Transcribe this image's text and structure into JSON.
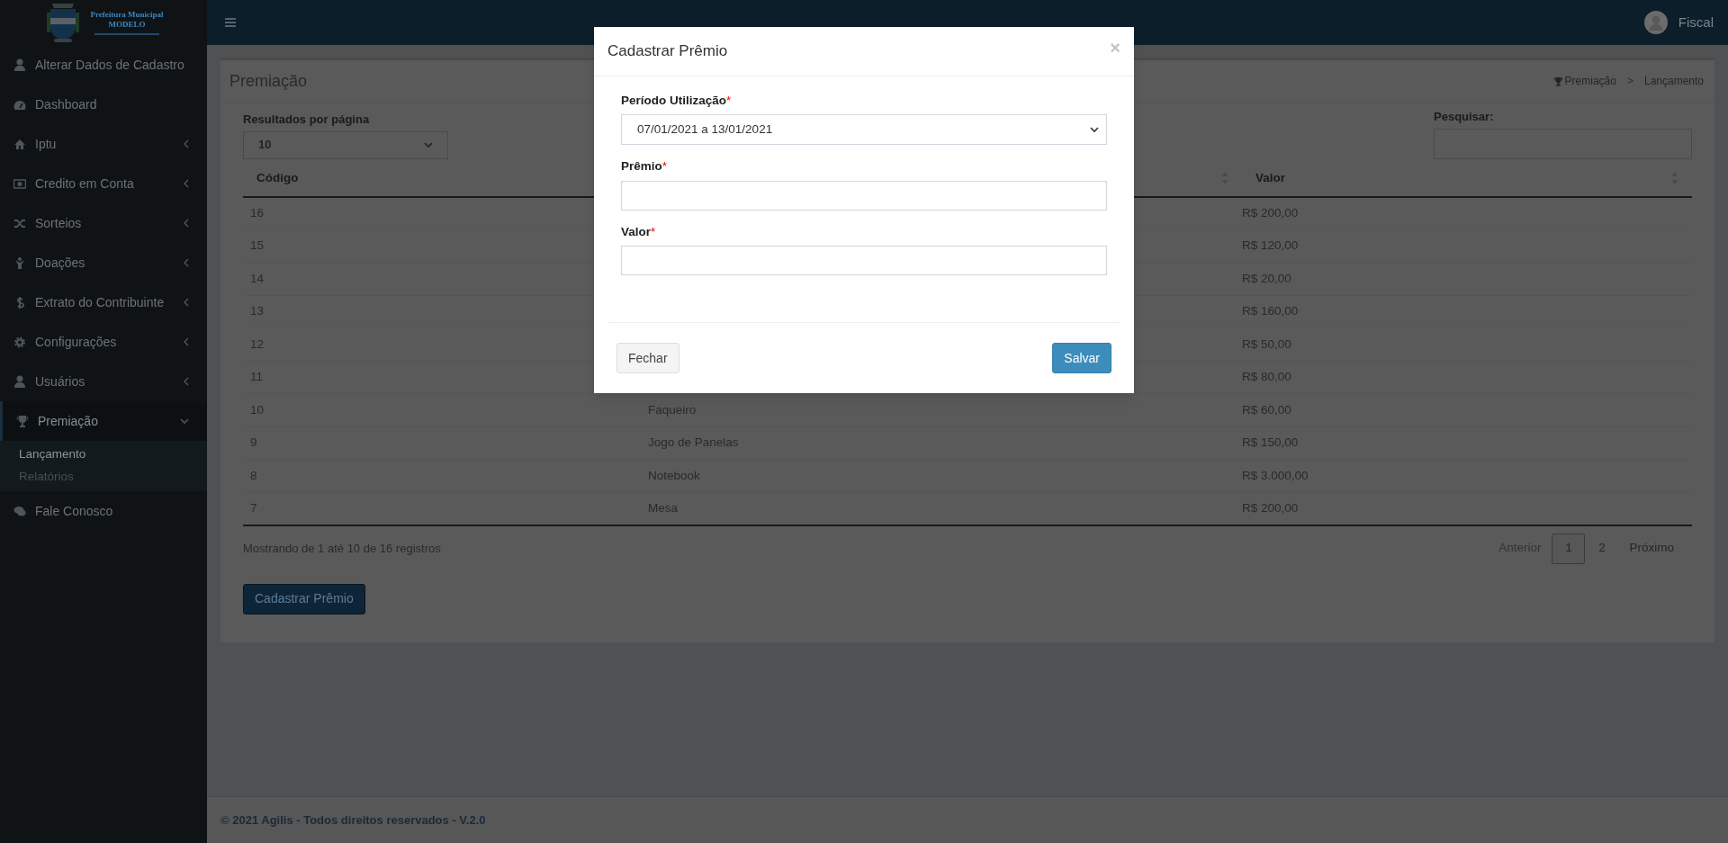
{
  "logo": {
    "lines": [
      "Prefeitura Municipal",
      "MODELO"
    ]
  },
  "sidebar": {
    "items": [
      {
        "label": "Alterar Dados de Cadastro",
        "kind": "link",
        "selected": false
      },
      {
        "label": "Dashboard",
        "kind": "link",
        "selected": false
      },
      {
        "label": "Iptu",
        "kind": "menu",
        "expanded": false,
        "selected": false
      },
      {
        "label": "Credito em Conta",
        "kind": "menu",
        "expanded": false,
        "selected": false
      },
      {
        "label": "Sorteios",
        "kind": "menu",
        "expanded": false,
        "selected": false
      },
      {
        "label": "Doações",
        "kind": "menu",
        "expanded": false,
        "selected": false
      },
      {
        "label": "Extrato do Contribuinte",
        "kind": "menu",
        "expanded": false,
        "selected": false
      },
      {
        "label": "Configurações",
        "kind": "menu",
        "expanded": false,
        "selected": false
      },
      {
        "label": "Usuários",
        "kind": "menu",
        "expanded": false,
        "selected": false
      },
      {
        "label": "Premiação",
        "kind": "menu",
        "expanded": true,
        "selected": true,
        "children": [
          {
            "label": "Lançamento",
            "selected": true
          },
          {
            "label": "Relatórios",
            "selected": false
          }
        ]
      },
      {
        "label": "Fale Conosco",
        "kind": "link",
        "selected": false
      }
    ]
  },
  "header": {
    "user": "Fiscal"
  },
  "panel": {
    "title": "Premiação",
    "breadcrumb": [
      "Premiação",
      "Lançamento"
    ],
    "breadcrumb_separator": ">"
  },
  "page_size": {
    "label": "Resultados por página",
    "value": "10"
  },
  "search": {
    "label": "Pesquisar:"
  },
  "table": {
    "columns": [
      "Código",
      "",
      "Valor"
    ],
    "rows": [
      {
        "codigo": "16",
        "valor": "R$ 200,00"
      },
      {
        "codigo": "15",
        "valor": "R$ 120,00"
      },
      {
        "codigo": "14",
        "valor": "R$ 20,00"
      },
      {
        "codigo": "13",
        "valor": "R$ 160,00"
      },
      {
        "codigo": "12",
        "valor": "R$ 50,00"
      },
      {
        "codigo": "11",
        "valor": "R$ 80,00"
      },
      {
        "codigo": "10",
        "premio": "Faqueiro",
        "valor": "R$ 60,00"
      },
      {
        "codigo": "9",
        "premio": "Jogo de Panelas",
        "valor": "R$ 150,00"
      },
      {
        "codigo": "8",
        "premio": "Notebook",
        "valor": "R$ 3.000,00"
      },
      {
        "codigo": "7",
        "premio": "Mesa",
        "valor": "R$ 200,00"
      }
    ]
  },
  "info": "Mostrando de 1 até 10 de 16 registros",
  "pagination": {
    "previous": "Anterior",
    "next": "Próximo",
    "pages": [
      {
        "label": "1",
        "selected": true
      },
      {
        "label": "2",
        "selected": false
      }
    ]
  },
  "add_button": "Cadastrar Prêmio",
  "footer": "© 2021 Agilis - Todos direitos reservados - V.2.0",
  "modal": {
    "title": "Cadastrar Prêmio",
    "close": "×",
    "fields": [
      {
        "label": "Período Utilização",
        "required_mark": "*",
        "kind": "select",
        "value": "07/01/2021 a 13/01/2021"
      },
      {
        "label": "Prêmio",
        "required_mark": "*",
        "kind": "text"
      },
      {
        "label": "Valor",
        "required_mark": "*",
        "kind": "text"
      }
    ],
    "buttons": [
      {
        "label": "Fechar",
        "kind": "default"
      },
      {
        "label": "Salvar",
        "kind": "primary"
      }
    ]
  }
}
